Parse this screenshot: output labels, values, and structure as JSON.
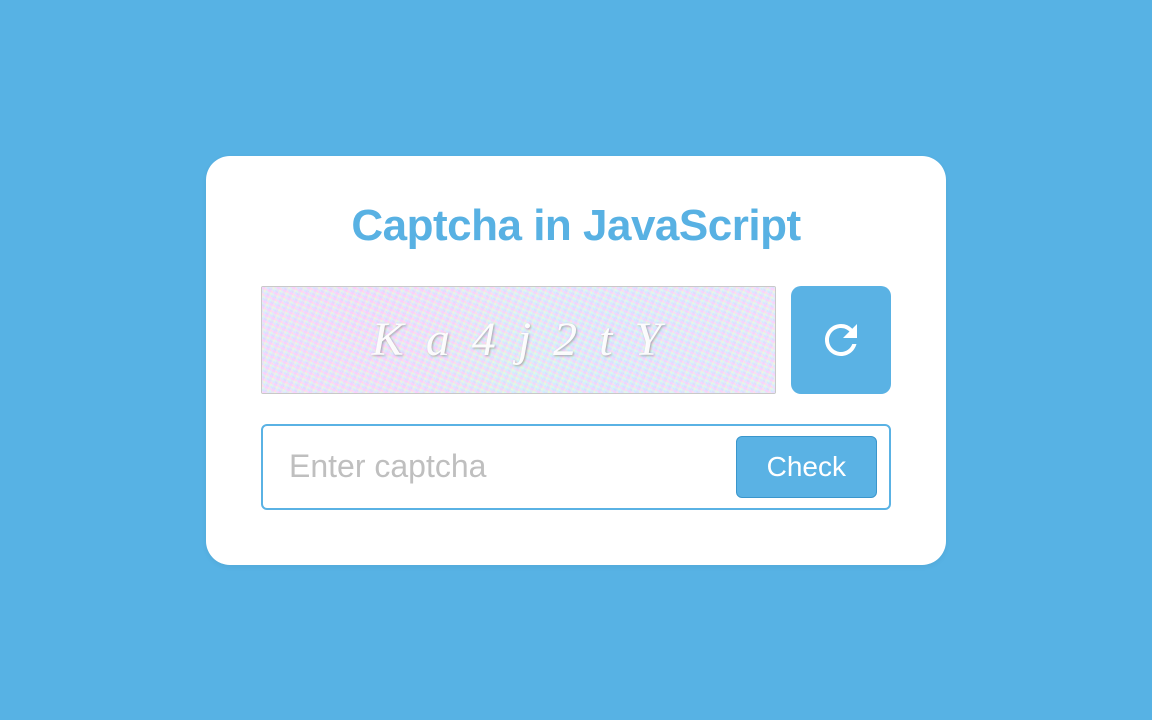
{
  "title": "Captcha in JavaScript",
  "captcha_value": "Ka4j2tY",
  "input": {
    "placeholder": "Enter captcha",
    "value": ""
  },
  "check_label": "Check",
  "colors": {
    "accent": "#5ab2e4",
    "page_bg": "#57b2e4"
  }
}
